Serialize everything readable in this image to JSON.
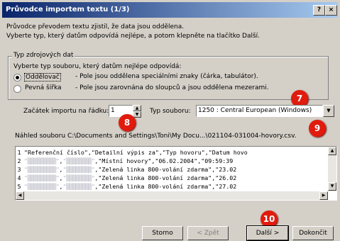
{
  "window": {
    "title": "Průvodce importem textu (1/3)",
    "help_label": "?",
    "close_label": "×"
  },
  "intro": {
    "line1": "Průvodce převodem textu zjistil, že data jsou oddělena.",
    "line2": "Vyberte typ, který datům odpovídá nejlépe, a potom klepněte na tlačítko Další."
  },
  "source_type": {
    "group_title": "Typ zdrojových dat",
    "prompt": "Vyberte typ souboru, který datům nejlépe odpovídá:",
    "options": [
      {
        "label": "Oddělovač",
        "description": "- Pole jsou oddělena speciálními znaky (čárka, tabulátor).",
        "selected": true
      },
      {
        "label": "Pevná šířka",
        "description": "- Pole jsou zarovnána do sloupců a jsou oddělena mezerami.",
        "selected": false
      }
    ]
  },
  "start_row": {
    "label": "Začátek importu na řádku:",
    "value": "1"
  },
  "file_type": {
    "label": "Typ souboru:",
    "value": "1250 : Central European (Windows)"
  },
  "preview": {
    "label": "Náhled souboru C:\\Documents and Settings\\Toni\\My Docu...\\021104-031004-hovory.csv.",
    "rows": [
      {
        "num": "1",
        "text": "\"Referenční číslo\",\"Detailní výpis za\",\"Typ hovoru\",\"Datum hovo"
      },
      {
        "num": "2",
        "redacted1": "\"▒▒▒▒▒▒▒▒▒\"",
        "redacted2": "\"▒▒▒▒▒▒▒▒\"",
        "text": ",\"Místní hovory\",\"06.02.2004\",\"09:59:39"
      },
      {
        "num": "3",
        "redacted1": "\"▒▒▒▒▒▒▒▒▒\"",
        "redacted2": "\"▒▒▒▒▒▒▒▒\"",
        "text": ",\"Zelená linka 800-volání zdarma\",\"23.02"
      },
      {
        "num": "4",
        "redacted1": "\"▒▒▒▒▒▒▒▒▒\"",
        "redacted2": "\"▒▒▒▒▒▒▒▒\"",
        "text": ",\"Zelená linka 800-volání zdarma\",\"26.02"
      },
      {
        "num": "5",
        "redacted1": "\"▒▒▒▒▒▒▒▒▒\"",
        "redacted2": "\"▒▒▒▒▒▒▒▒\"",
        "text": ",\"Zelená linka 800-volání zdarma\",\"27.02"
      }
    ]
  },
  "buttons": {
    "cancel": "Storno",
    "back": "< Zpět",
    "next": "Další >",
    "finish": "Dokončit"
  },
  "callouts": [
    "7",
    "8",
    "9",
    "10"
  ],
  "colors": {
    "callout": "#e11b0d",
    "titlebar_start": "#0a246a",
    "titlebar_end": "#a6caf0",
    "dialog_bg": "#d4d0c8"
  }
}
